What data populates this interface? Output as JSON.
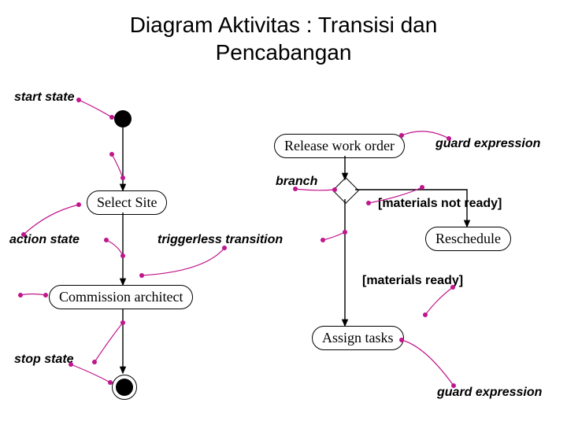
{
  "title_line1": "Diagram Aktivitas : Transisi dan",
  "title_line2": "Pencabangan",
  "labels": {
    "start_state": "start state",
    "branch": "branch",
    "guard_expression": "guard expression",
    "action_state": "action state",
    "triggerless_transition": "triggerless transition",
    "stop_state": "stop state"
  },
  "guards": {
    "materials_not_ready": "[materials not ready]",
    "materials_ready": "[materials ready]"
  },
  "activities": {
    "release_work_order": "Release work order",
    "select_site": "Select Site",
    "reschedule": "Reschedule",
    "commission_architect": "Commission architect",
    "assign_tasks": "Assign tasks"
  }
}
